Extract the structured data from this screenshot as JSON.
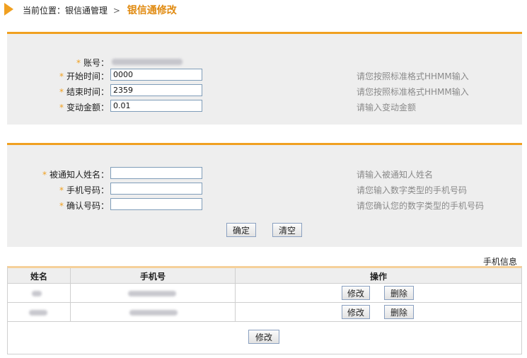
{
  "breadcrumb": {
    "prefix": "当前位置：银信通管理",
    "separator": ">",
    "current": "银信通修改"
  },
  "form1": {
    "account": {
      "label": "账号："
    },
    "start": {
      "label": "开始时间：",
      "value": "0000",
      "hint": "请您按照标准格式HHMM输入"
    },
    "end": {
      "label": "结束时间：",
      "value": "2359",
      "hint": "请您按照标准格式HHMM输入"
    },
    "amount": {
      "label": "变动金额：",
      "value": "0.01",
      "hint": "请输入变动金额"
    }
  },
  "form2": {
    "name": {
      "label": "被通知人姓名：",
      "value": "",
      "hint": "请输入被通知人姓名"
    },
    "phone": {
      "label": "手机号码：",
      "value": "",
      "hint": "请您输入数字类型的手机号码"
    },
    "confirm": {
      "label": "确认号码：",
      "value": "",
      "hint": "请您确认您的数字类型的手机号码"
    },
    "ok_label": "确定",
    "clear_label": "清空"
  },
  "table": {
    "caption": "手机信息",
    "headers": [
      "姓名",
      "手机号",
      "操作"
    ],
    "rows": [
      {
        "edit_label": "修改",
        "delete_label": "删除"
      },
      {
        "edit_label": "修改",
        "delete_label": "删除"
      }
    ],
    "footer_button": "修改"
  },
  "colors": {
    "accent": "#f0a020",
    "panel": "#eeeeee",
    "hint": "#8a8a8a"
  }
}
